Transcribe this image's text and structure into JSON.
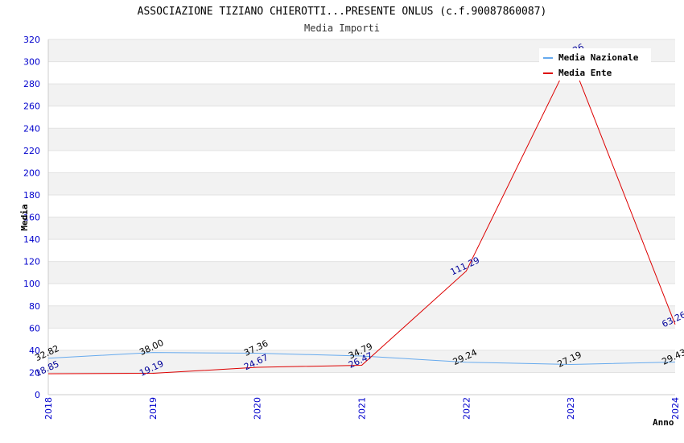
{
  "chart_data": {
    "type": "line",
    "title": "ASSOCIAZIONE TIZIANO CHIEROTTI...PRESENTE ONLUS (c.f.90087860087)",
    "subtitle": "Media Importi",
    "xlabel": "Anno",
    "ylabel": "Media",
    "ylim": [
      0,
      320
    ],
    "yticks": [
      "0",
      "20",
      "40",
      "60",
      "80",
      "100",
      "120",
      "140",
      "160",
      "180",
      "200",
      "220",
      "240",
      "260",
      "280",
      "300",
      "320"
    ],
    "categories": [
      "2018",
      "2019",
      "2020",
      "2021",
      "2022",
      "2023",
      "2024"
    ],
    "grid": "horizontal bands",
    "legend_position": "top-right",
    "series": [
      {
        "name": "Media Nazionale",
        "color": "#66aaee",
        "label_color": "#000000",
        "values": [
          32.82,
          38.0,
          37.36,
          34.79,
          29.24,
          27.19,
          29.43
        ],
        "labels": [
          "32.82",
          "38.00",
          "37.36",
          "34.79",
          "29.24",
          "27.19",
          "29.43"
        ]
      },
      {
        "name": "Media Ente",
        "color": "#dd0000",
        "label_color": "#000099",
        "values": [
          18.85,
          19.19,
          24.67,
          26.47,
          111.29,
          303.36,
          63.26
        ],
        "labels": [
          "18.85",
          "19.19",
          "24.67",
          "26.47",
          "111.29",
          "303.36",
          "63.26"
        ]
      }
    ]
  }
}
